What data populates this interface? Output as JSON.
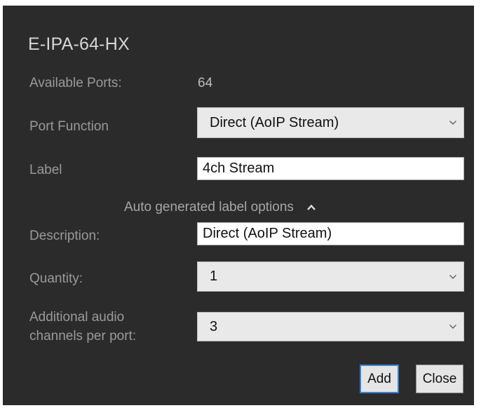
{
  "dialog": {
    "title": "E-IPA-64-HX",
    "available_ports_label": "Available Ports:",
    "available_ports_value": "64",
    "port_function_label": "Port Function",
    "port_function_value": "Direct (AoIP Stream)",
    "label_label": "Label",
    "label_value": "4ch Stream",
    "auto_label_toggle": "Auto generated label options",
    "description_label": "Description:",
    "description_value": "Direct (AoIP Stream)",
    "quantity_label": "Quantity:",
    "quantity_value": "1",
    "additional_label_line1": "Additional audio",
    "additional_label_line2": "channels per port:",
    "additional_value": "3",
    "add_button": "Add",
    "close_button": "Close"
  },
  "icons": {
    "dropdown": "chevron-down-icon",
    "toggle": "chevron-up-icon"
  },
  "colors": {
    "dialog_bg": "#2b2b2b",
    "label_text": "#9a9a9a",
    "focus_border": "#3c7fd0"
  }
}
